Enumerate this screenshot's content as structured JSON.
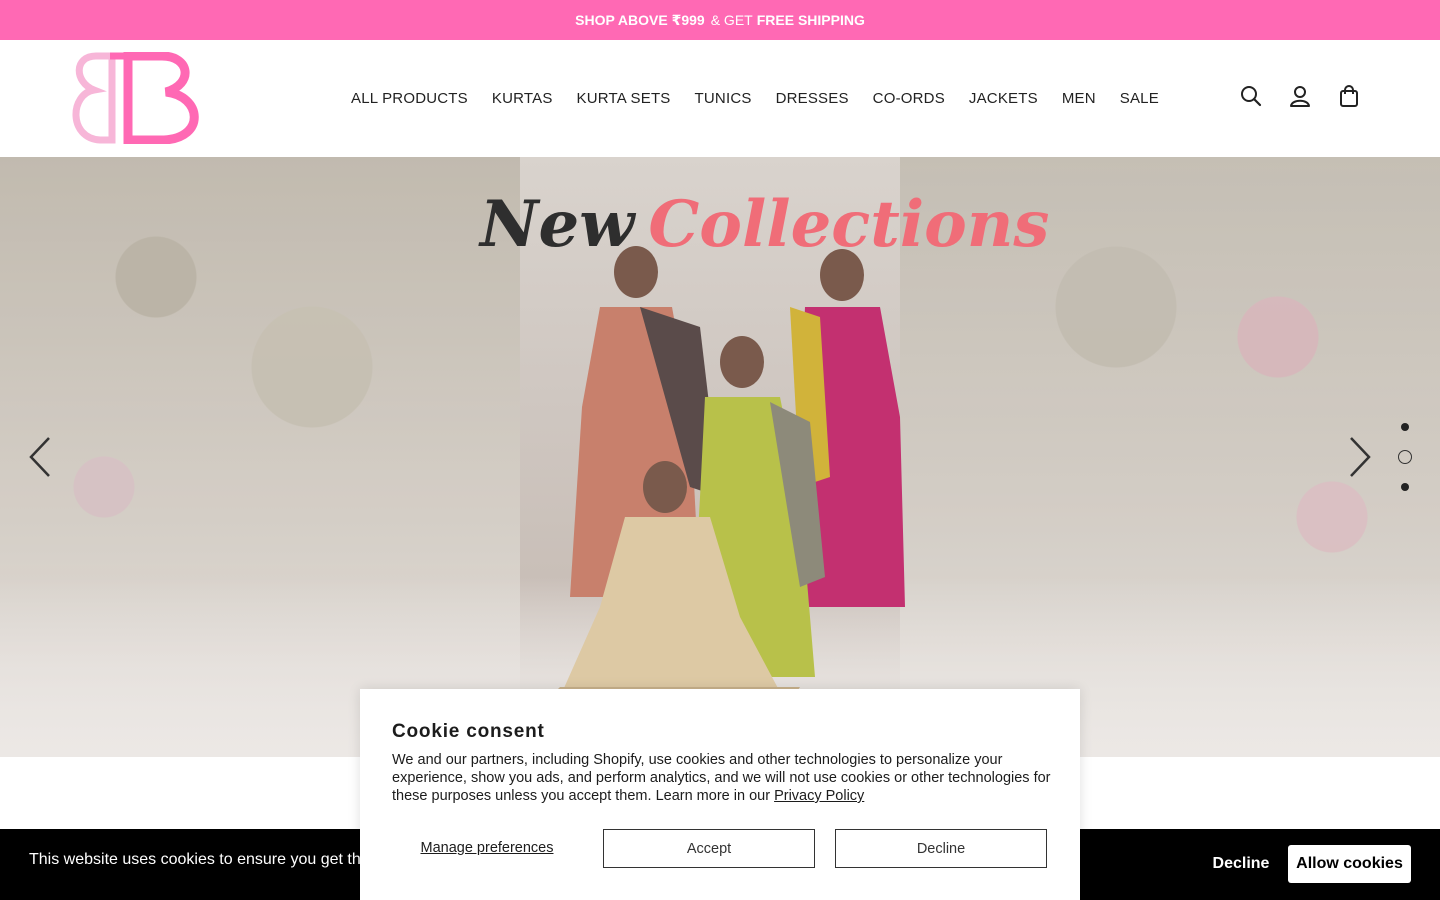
{
  "announcement": {
    "part1": "SHOP ABOVE ₹999",
    "part2": "& GET",
    "part3": "FREE SHIPPING"
  },
  "header": {
    "logo_alt": "BB",
    "nav": [
      "ALL PRODUCTS",
      "KURTAS",
      "KURTA SETS",
      "TUNICS",
      "DRESSES",
      "CO-ORDS",
      "JACKETS",
      "MEN",
      "SALE"
    ],
    "icons": [
      "search-icon",
      "account-icon",
      "bag-icon"
    ]
  },
  "hero": {
    "headline_word1": "New",
    "headline_word2": "Collections",
    "slide_count": 3,
    "active_slide": 2
  },
  "cookie_bar": {
    "message": "This website uses cookies to ensure you get the",
    "decline_label": "Decline",
    "allow_label": "Allow cookies"
  },
  "consent": {
    "title": "Cookie consent",
    "body": "We and our partners, including Shopify, use cookies and other technologies to personalize your experience, show you ads, and perform analytics, and we will not use cookies or other technologies for these purposes unless you accept them. Learn more in our ",
    "policy_link": "Privacy Policy",
    "manage_label": "Manage preferences",
    "accept_label": "Accept",
    "decline_label": "Decline"
  },
  "colors": {
    "brand_pink": "#ff69b4",
    "accent_coral": "#f06d78"
  }
}
